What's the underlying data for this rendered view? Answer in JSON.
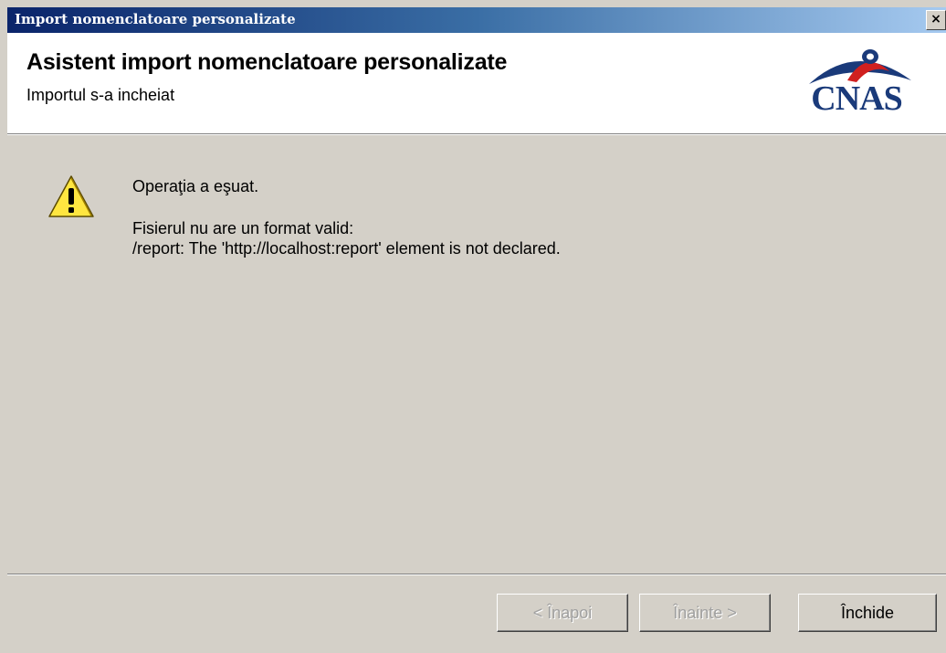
{
  "window": {
    "title": "Import nomenclatoare personalizate",
    "close_glyph": "×"
  },
  "header": {
    "title": "Asistent import nomenclatoare personalizate",
    "subtitle": "Importul s-a incheiat",
    "logo_text": "CNAS"
  },
  "content": {
    "icon": "warning-icon",
    "status": "Operaţia a eşuat.",
    "error_line1": "Fisierul nu are un format valid:",
    "error_line2": "/report: The 'http://localhost:report' element is not declared."
  },
  "footer": {
    "back_label": "< Înapoi",
    "next_label": "Înainte >",
    "close_label": "Închide"
  },
  "colors": {
    "titlebar_start": "#0a246a",
    "titlebar_end": "#a6caf0",
    "dialog_bg": "#d4d0c8",
    "logo_blue": "#1a3a7a",
    "logo_red": "#d0201f"
  }
}
